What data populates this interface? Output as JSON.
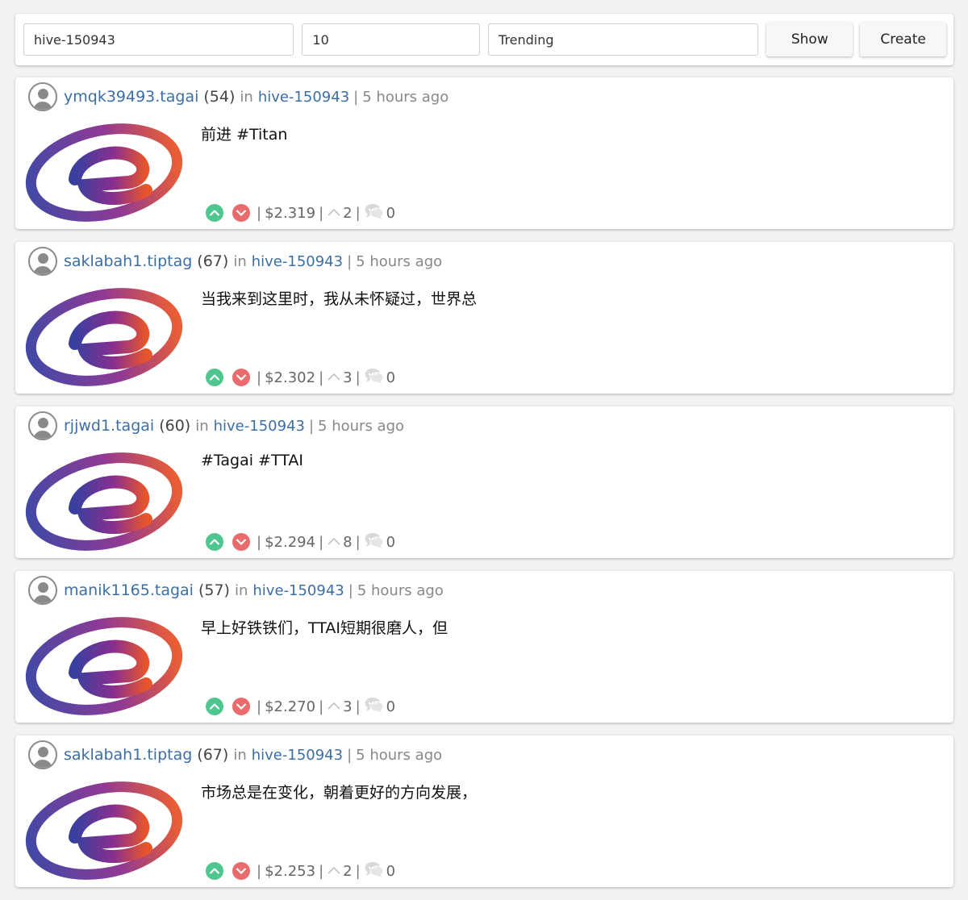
{
  "filters": {
    "tag_value": "hive-150943",
    "count_value": "10",
    "sort_value": "Trending",
    "show_label": "Show",
    "create_label": "Create"
  },
  "colors": {
    "link": "#3c6ea5",
    "upvote": "#4ec78f",
    "downvote": "#e96b6b"
  },
  "labels": {
    "in": "in"
  },
  "posts": [
    {
      "author": "ymqk39493.tagai",
      "reputation": "(54)",
      "community": "hive-150943",
      "time": "5 hours ago",
      "title": "前进 #Titan",
      "payout": "$2.319",
      "votes": "2",
      "comments": "0"
    },
    {
      "author": "saklabah1.tiptag",
      "reputation": "(67)",
      "community": "hive-150943",
      "time": "5 hours ago",
      "title": "当我来到这里时，我从未怀疑过，世界总",
      "payout": "$2.302",
      "votes": "3",
      "comments": "0"
    },
    {
      "author": "rjjwd1.tagai",
      "reputation": "(60)",
      "community": "hive-150943",
      "time": "5 hours ago",
      "title": "#Tagai #TTAI",
      "payout": "$2.294",
      "votes": "8",
      "comments": "0"
    },
    {
      "author": "manik1165.tagai",
      "reputation": "(57)",
      "community": "hive-150943",
      "time": "5 hours ago",
      "title": "早上好铁铁们，TTAI短期很磨人，但",
      "payout": "$2.270",
      "votes": "3",
      "comments": "0"
    },
    {
      "author": "saklabah1.tiptag",
      "reputation": "(67)",
      "community": "hive-150943",
      "time": "5 hours ago",
      "title": "市场总是在变化，朝着更好的方向发展，",
      "payout": "$2.253",
      "votes": "2",
      "comments": "0"
    }
  ]
}
